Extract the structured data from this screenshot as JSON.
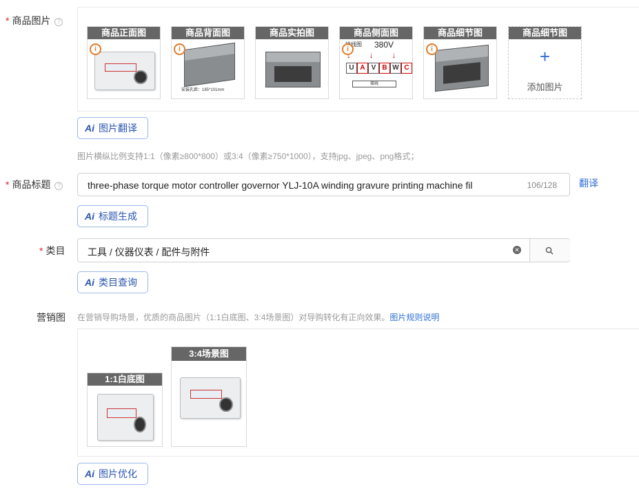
{
  "product_images": {
    "label": "商品图片",
    "help": "?",
    "tiles": [
      "商品正面图",
      "商品背面图",
      "商品实拍图",
      "商品侧面图",
      "商品细节图",
      "商品细节图"
    ],
    "add_label": "添加图片",
    "plus": "+",
    "info_glyph": "i",
    "side_view": {
      "voltage": "380V",
      "diagram_label": "接线图",
      "terminals": [
        "U",
        "A",
        "V",
        "B",
        "W",
        "C"
      ],
      "bottom_label": "接线"
    },
    "back_view": {
      "size_note": "安装孔距：185*101mm"
    },
    "ai_translate": "图片翻译",
    "hint": "图片横纵比例支持1:1（像素≥800*800）或3:4（像素≥750*1000），支持jpg、jpeg、png格式；"
  },
  "product_title": {
    "label": "商品标题",
    "help": "?",
    "value": "three-phase torque motor controller governor YLJ-10A winding gravure printing machine fil",
    "counter": "106/128",
    "translate_link": "翻译",
    "ai_generate": "标题生成"
  },
  "category": {
    "label": "类目",
    "value": "工具 / 仪器仪表 / 配件与附件",
    "ai_query": "类目查询"
  },
  "marketing": {
    "label": "营销图",
    "hint": "在营销导购场景，优质的商品图片（1:1白底图、3:4场景图）对导购转化有正向效果。",
    "hint_link": "图片规则说明",
    "tiles": [
      "1:1白底图",
      "3:4场景图"
    ],
    "ai_optimize": "图片优化"
  },
  "ai_glyph": "Ai",
  "required_mark": "*",
  "colors": {
    "accent": "#2f6fd6",
    "required": "#e02020",
    "caption_bg": "#666666",
    "info": "#e07b2a"
  }
}
